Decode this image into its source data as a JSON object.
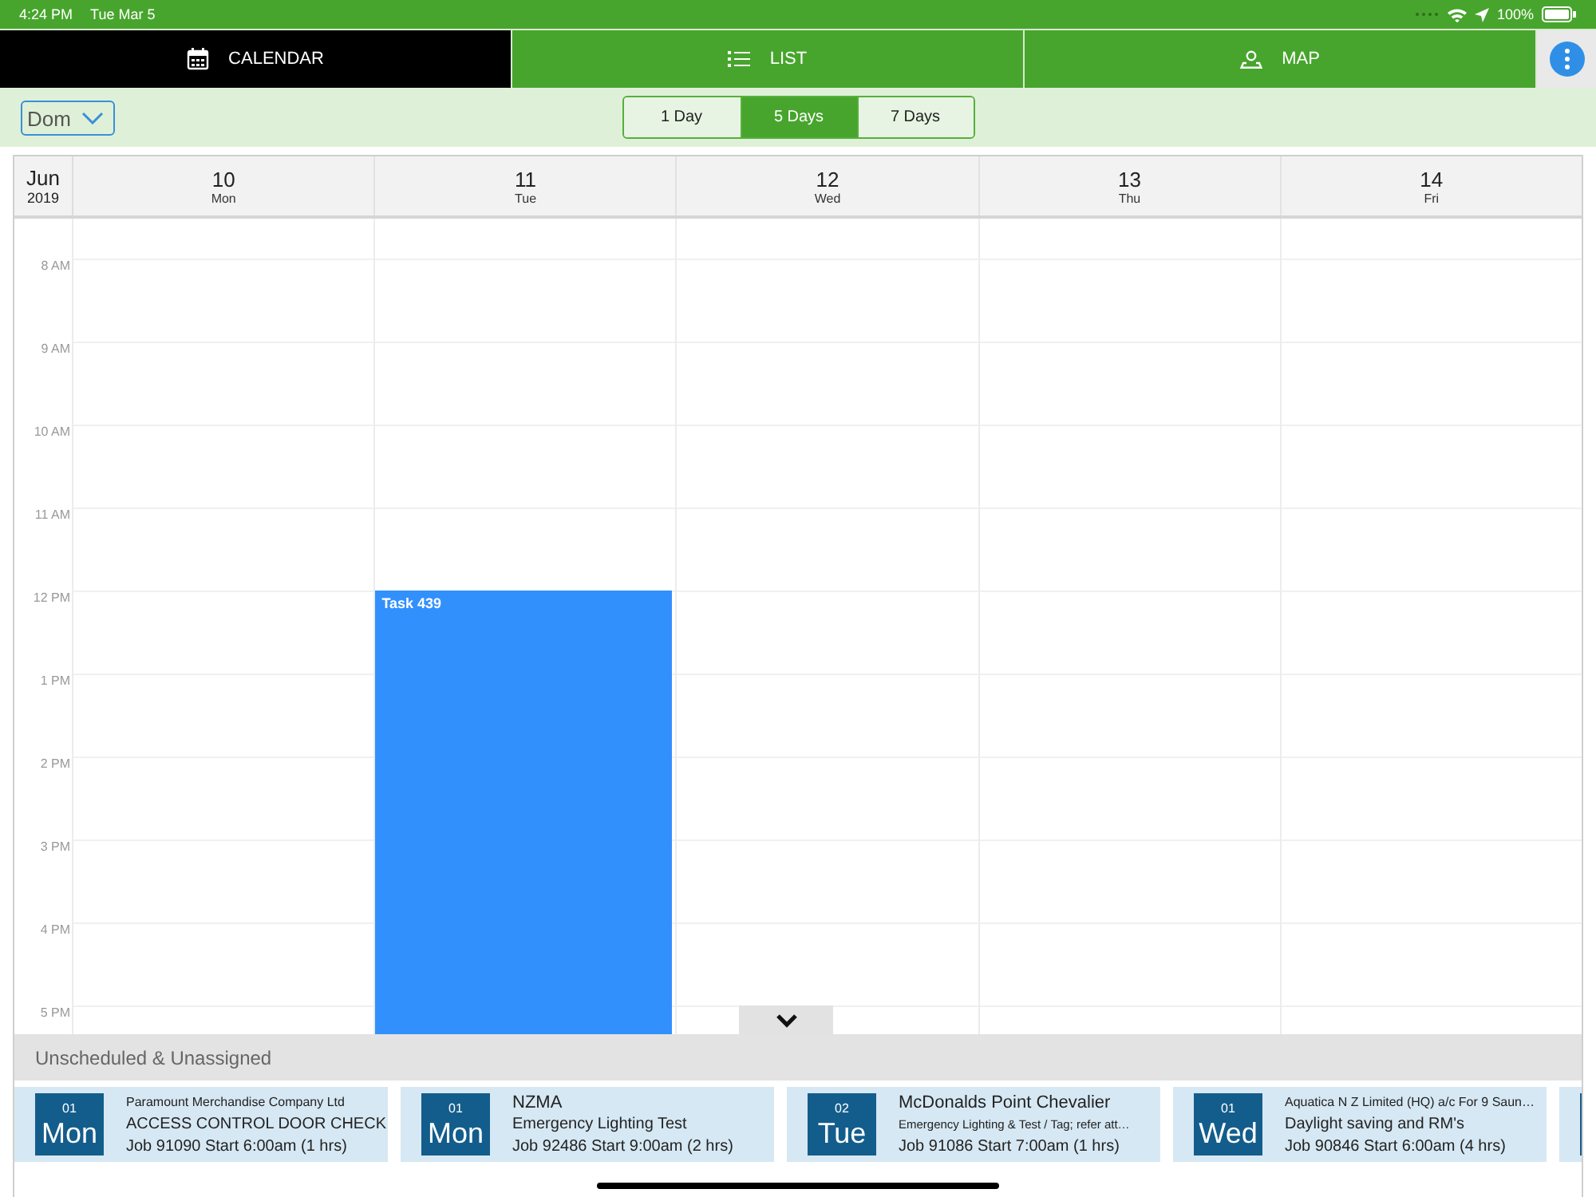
{
  "status_bar": {
    "time": "4:24 PM",
    "date": "Tue Mar 5",
    "battery": "100%"
  },
  "tabs": [
    {
      "label": "CALENDAR",
      "kind": "calendar",
      "selected": true
    },
    {
      "label": "LIST",
      "kind": "list",
      "selected": false
    },
    {
      "label": "MAP",
      "kind": "map",
      "selected": false
    }
  ],
  "toolbar": {
    "person": "Dom",
    "ranges": [
      {
        "label": "1 Day",
        "selected": false
      },
      {
        "label": "5 Days",
        "selected": true
      },
      {
        "label": "7 Days",
        "selected": false
      }
    ]
  },
  "calendar": {
    "month": "Jun",
    "year": "2019",
    "days": [
      {
        "date": "10",
        "weekday": "Mon"
      },
      {
        "date": "11",
        "weekday": "Tue",
        "slots": [
          {
            "kind": "free"
          },
          {
            "kind": "free"
          },
          {
            "kind": "free"
          },
          {
            "kind": "free"
          },
          {
            "kind": "event",
            "title": "Task 439"
          }
        ]
      },
      {
        "date": "12",
        "weekday": "Wed"
      },
      {
        "date": "13",
        "weekday": "Thu"
      },
      {
        "date": "14",
        "weekday": "Fri"
      }
    ],
    "hours": [
      "8 AM",
      "9 AM",
      "10 AM",
      "11 AM",
      "12 PM",
      "1 PM",
      "2 PM",
      "3 PM",
      "4 PM",
      "5 PM"
    ]
  },
  "unscheduled": {
    "title": "Unscheduled & Unassigned",
    "cards": [
      {
        "kind": "job",
        "day_number": "01",
        "weekday": "Mon",
        "title": "Paramount Merchandise Company Ltd",
        "description": "ACCESS CONTROL DOOR CHECK",
        "job": "Job 91090 Start 6:00am (1 hrs)"
      },
      {
        "kind": "job",
        "day_number": "01",
        "weekday": "Mon",
        "title": "NZMA",
        "description": "Emergency Lighting Test",
        "job": "Job 92486 Start 9:00am (2 hrs)"
      },
      {
        "kind": "job",
        "day_number": "02",
        "weekday": "Tue",
        "title": "McDonalds Point Chevalier",
        "description": "Emergency Lighting & Test / Tag; refer att…",
        "job": "Job 91086 Start 7:00am (1 hrs)"
      },
      {
        "kind": "job",
        "day_number": "01",
        "weekday": "Wed",
        "title": "Aquatica N Z Limited (HQ) a/c For 9 Saun…",
        "description": "Daylight saving and RM's",
        "job": "Job 90846 Start 6:00am (4 hrs)"
      },
      {
        "kind": "edge"
      }
    ]
  }
}
